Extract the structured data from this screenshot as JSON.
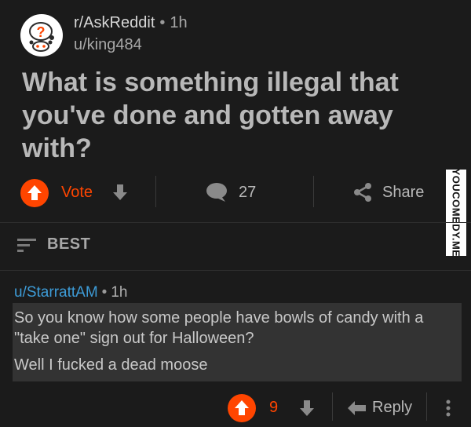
{
  "post": {
    "subreddit": "r/AskReddit",
    "separator": "•",
    "age": "1h",
    "author": "u/king484",
    "title": "What is something illegal that you've done and gotten away with?",
    "vote_label": "Vote",
    "comment_count": "27",
    "share_label": "Share"
  },
  "watermark": "YOUCOMEDY.ME",
  "sort": {
    "label": "BEST"
  },
  "comment": {
    "author": "u/StarrattAM",
    "separator": "•",
    "age": "1h",
    "paragraph_1": "So you know how some people have bowls of candy with a \"take one\" sign out for Halloween?",
    "paragraph_2": "Well I fucked a dead moose",
    "score": "9",
    "reply_label": "Reply"
  },
  "colors": {
    "background": "#1b1b1b",
    "upvote": "#ff4500",
    "username_link": "#3d9bd6",
    "comment_highlight": "#333333"
  }
}
